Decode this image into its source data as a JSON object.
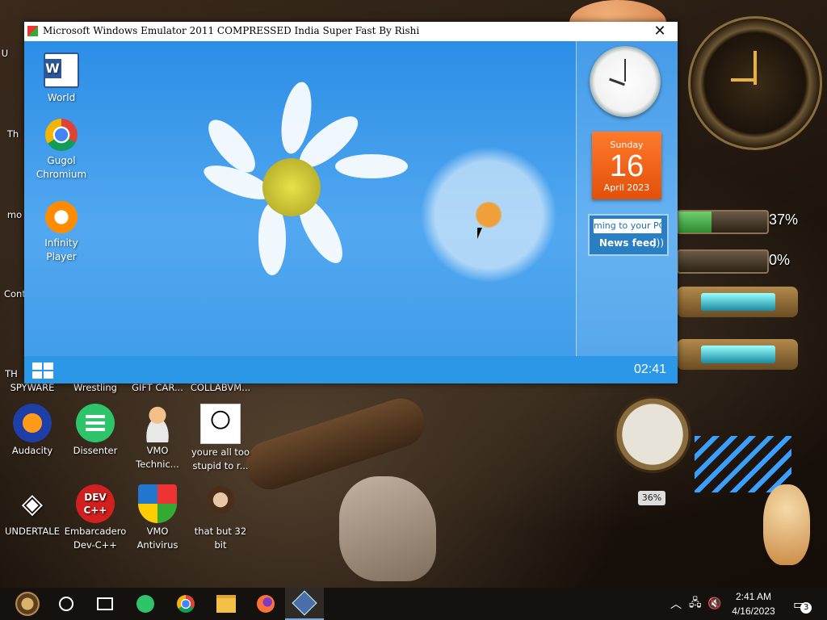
{
  "emulator": {
    "title": "Microsoft Windows Emulator 2011 COMPRESSED India Super Fast By Rishi",
    "close_glyph": "✕",
    "desktop_icons": [
      {
        "label": "World",
        "icon": "word-icon"
      },
      {
        "label": "Gugol Chromium",
        "icon": "chromium-icon"
      },
      {
        "label": "Infinity Player",
        "icon": "media-player-icon"
      }
    ],
    "calendar": {
      "day_name": "Sunday",
      "day": "16",
      "month_year": "April 2023"
    },
    "news": {
      "ticker": "ming to your PC",
      "label": "News feed"
    },
    "taskbar_time": "02:41"
  },
  "desktop_icons": [
    {
      "label": "SPYWARE",
      "icon": "spyware-icon"
    },
    {
      "label": "Wrestling",
      "icon": "wrestling-icon"
    },
    {
      "label": "GIFT CAR...",
      "icon": "gift-card-icon"
    },
    {
      "label": "COLLABVM...",
      "icon": "collabvm-icon"
    },
    {
      "label": "Audacity",
      "icon": "audacity-icon"
    },
    {
      "label": "Dissenter",
      "icon": "dissenter-icon"
    },
    {
      "label": "VMO Technic...",
      "icon": "vmo-technician-icon"
    },
    {
      "label": "youre all too stupid to r...",
      "icon": "portrait-icon"
    },
    {
      "label": "UNDERTALE",
      "icon": "unity-icon"
    },
    {
      "label": "Embarcadero Dev-C++",
      "icon": "devcpp-icon"
    },
    {
      "label": "VMO Antivirus",
      "icon": "shield-icon"
    },
    {
      "label": "that but 32 bit",
      "icon": "portrait2-icon"
    }
  ],
  "partial_left_labels": [
    "U",
    "Th",
    "mo",
    "Conti",
    "TH"
  ],
  "gauges": [
    {
      "percent_text": "37%",
      "value": 0.37
    },
    {
      "percent_text": "0%",
      "value": 0.0
    }
  ],
  "pressure_gauge_text": "36%",
  "taskbar": {
    "apps": [
      "steampunk-start-icon",
      "cortana-circle-icon",
      "task-view-icon",
      "dissenter-icon",
      "chrome-icon",
      "file-explorer-icon",
      "firefox-icon",
      "virtualbox-icon"
    ],
    "time": "2:41 AM",
    "date": "4/16/2023",
    "notification_count": "3"
  },
  "colors": {
    "emulator_bg": "#2c8ee6",
    "calendar": "#ff7a2a",
    "taskbar": "#14110e"
  }
}
